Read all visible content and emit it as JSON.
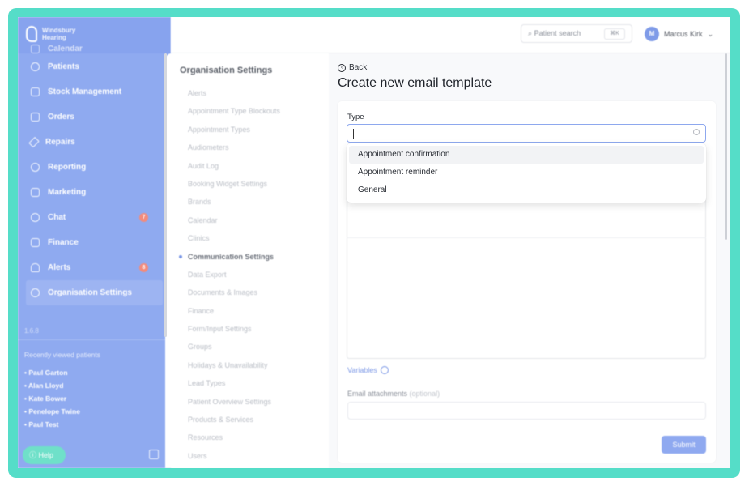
{
  "brand": {
    "name_line1": "Windsbury",
    "name_line2": "Hearing"
  },
  "sidebar": {
    "items": [
      {
        "label": "Calendar"
      },
      {
        "label": "Patients"
      },
      {
        "label": "Stock Management"
      },
      {
        "label": "Orders"
      },
      {
        "label": "Repairs"
      },
      {
        "label": "Reporting"
      },
      {
        "label": "Marketing"
      },
      {
        "label": "Chat",
        "badge": "7"
      },
      {
        "label": "Finance"
      },
      {
        "label": "Alerts",
        "badge": "8"
      },
      {
        "label": "Organisation Settings",
        "active": true
      }
    ],
    "version": "1.6.8",
    "recent_title": "Recently viewed patients",
    "recent": [
      "Paul Garton",
      "Alan Lloyd",
      "Kate Bower",
      "Penelope Twine",
      "Paul Test"
    ],
    "help_label": "Help"
  },
  "header": {
    "search_label": "Patient search",
    "search_shortcut": "⌘K",
    "user_initial": "M",
    "user_name": "Marcus Kirk"
  },
  "settings": {
    "title": "Organisation Settings",
    "items": [
      "Alerts",
      "Appointment Type Blockouts",
      "Appointment Types",
      "Audiometers",
      "Audit Log",
      "Booking Widget Settings",
      "Brands",
      "Calendar",
      "Clinics",
      "Communication Settings",
      "Data Export",
      "Documents & Images",
      "Finance",
      "Form/Input Settings",
      "Groups",
      "Holidays & Unavailability",
      "Lead Types",
      "Patient Overview Settings",
      "Products & Services",
      "Resources",
      "Users"
    ],
    "active_index": 9
  },
  "main": {
    "back_label": "Back",
    "title": "Create new email template",
    "type_label": "Type",
    "type_value": "",
    "dropdown_options": [
      "Appointment confirmation",
      "Appointment reminder",
      "General"
    ],
    "variables_label": "Variables",
    "attachments_label": "Email attachments",
    "attachments_optional": "(optional)",
    "submit_label": "Submit"
  },
  "colors": {
    "frame": "#55ddc8",
    "sidebar": "#8faaf0",
    "accent": "#7b97e6",
    "submit": "#8fa9f0"
  }
}
